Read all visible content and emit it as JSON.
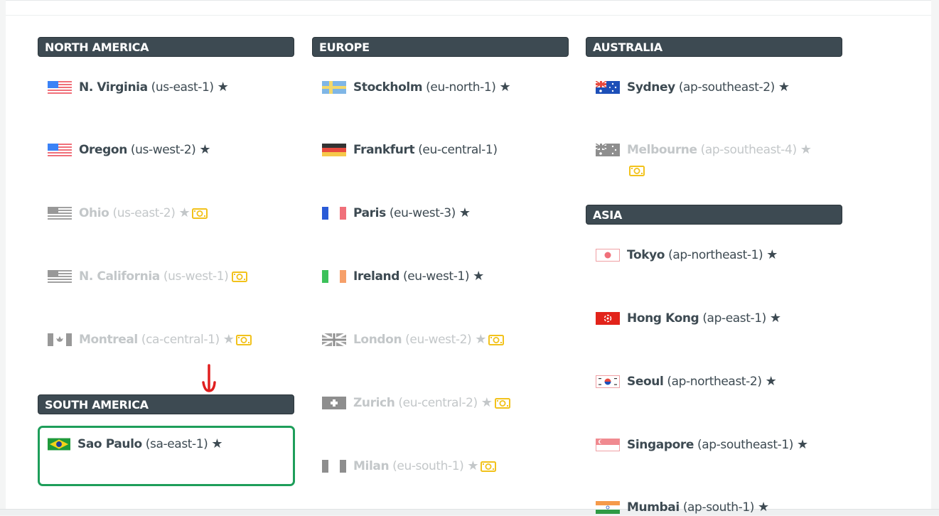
{
  "sections": {
    "north_america": "NORTH AMERICA",
    "europe": "EUROPE",
    "australia": "AUSTRALIA",
    "asia": "ASIA",
    "south_america": "SOUTH AMERICA"
  },
  "regions": {
    "n_virginia": {
      "name": "N. Virginia",
      "code": "(us-east-1)",
      "enabled": true
    },
    "oregon": {
      "name": "Oregon",
      "code": "(us-west-2)",
      "enabled": true
    },
    "ohio": {
      "name": "Ohio",
      "code": "(us-east-2)",
      "enabled": false
    },
    "n_california": {
      "name": "N. California",
      "code": "(us-west-1)",
      "enabled": false
    },
    "montreal": {
      "name": "Montreal",
      "code": "(ca-central-1)",
      "enabled": false
    },
    "sao_paulo": {
      "name": "Sao Paulo",
      "code": "(sa-east-1)",
      "enabled": true,
      "selected": true
    },
    "stockholm": {
      "name": "Stockholm",
      "code": "(eu-north-1)",
      "enabled": true
    },
    "frankfurt": {
      "name": "Frankfurt",
      "code": "(eu-central-1)",
      "enabled": true
    },
    "paris": {
      "name": "Paris",
      "code": "(eu-west-3)",
      "enabled": true
    },
    "ireland": {
      "name": "Ireland",
      "code": "(eu-west-1)",
      "enabled": true
    },
    "london": {
      "name": "London",
      "code": "(eu-west-2)",
      "enabled": false
    },
    "zurich": {
      "name": "Zurich",
      "code": "(eu-central-2)",
      "enabled": false
    },
    "milan": {
      "name": "Milan",
      "code": "(eu-south-1)",
      "enabled": false
    },
    "sydney": {
      "name": "Sydney",
      "code": "(ap-southeast-2)",
      "enabled": true
    },
    "melbourne": {
      "name": "Melbourne",
      "code": "(ap-southeast-4)",
      "enabled": false
    },
    "tokyo": {
      "name": "Tokyo",
      "code": "(ap-northeast-1)",
      "enabled": true
    },
    "hong_kong": {
      "name": "Hong Kong",
      "code": "(ap-east-1)",
      "enabled": true
    },
    "seoul": {
      "name": "Seoul",
      "code": "(ap-northeast-2)",
      "enabled": true
    },
    "singapore": {
      "name": "Singapore",
      "code": "(ap-southeast-1)",
      "enabled": true
    },
    "mumbai": {
      "name": "Mumbai",
      "code": "(ap-south-1)",
      "enabled": true
    }
  },
  "icons": {
    "star": "star-icon",
    "money": "money-icon",
    "arrow": "down-arrow-annotation"
  },
  "colors": {
    "header_bg": "#3d4a52",
    "text": "#3d4a52",
    "disabled_text": "#c3c7c9",
    "selected_border": "#1e9e5a",
    "money": "#f2c21b",
    "arrow": "#e01e1e"
  }
}
